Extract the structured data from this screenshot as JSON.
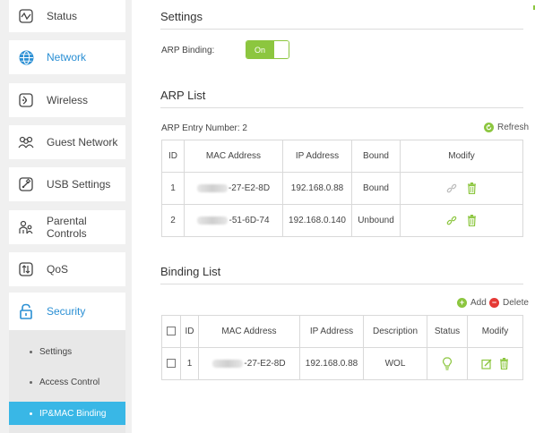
{
  "sidebar": {
    "items": [
      {
        "label": "Status",
        "icon": "activity-icon"
      },
      {
        "label": "Network",
        "icon": "globe-icon"
      },
      {
        "label": "Wireless",
        "icon": "wifi-icon"
      },
      {
        "label": "Guest Network",
        "icon": "users-icon"
      },
      {
        "label": "USB Settings",
        "icon": "usb-icon"
      },
      {
        "label": "Parental Controls",
        "icon": "parent-child-icon"
      },
      {
        "label": "QoS",
        "icon": "qos-icon"
      },
      {
        "label": "Security",
        "icon": "lock-icon"
      }
    ],
    "submenu": [
      {
        "label": "Settings"
      },
      {
        "label": "Access Control"
      },
      {
        "label": "IP&MAC Binding"
      }
    ]
  },
  "settings": {
    "title": "Settings",
    "arp_binding_label": "ARP Binding:",
    "toggle_label": "On"
  },
  "arp_list": {
    "title": "ARP List",
    "entry_number": "ARP Entry Number: 2",
    "refresh_label": "Refresh",
    "headers": [
      "ID",
      "MAC Address",
      "IP Address",
      "Bound",
      "Modify"
    ],
    "rows": [
      {
        "id": "1",
        "mac": "-27-E2-8D",
        "ip": "192.168.0.88",
        "bound": "Bound"
      },
      {
        "id": "2",
        "mac": "-51-6D-74",
        "ip": "192.168.0.140",
        "bound": "Unbound"
      }
    ]
  },
  "binding_list": {
    "title": "Binding List",
    "add_label": "Add",
    "delete_label": "Delete",
    "headers": [
      "",
      "ID",
      "MAC Address",
      "IP Address",
      "Description",
      "Status",
      "Modify"
    ],
    "rows": [
      {
        "id": "1",
        "mac": "-27-E2-8D",
        "ip": "192.168.0.88",
        "description": "WOL"
      }
    ]
  },
  "colors": {
    "accent_green": "#8cc63f",
    "accent_blue": "#2a8fd4",
    "submenu_active": "#39b7e6",
    "delete_red": "#e53935"
  }
}
